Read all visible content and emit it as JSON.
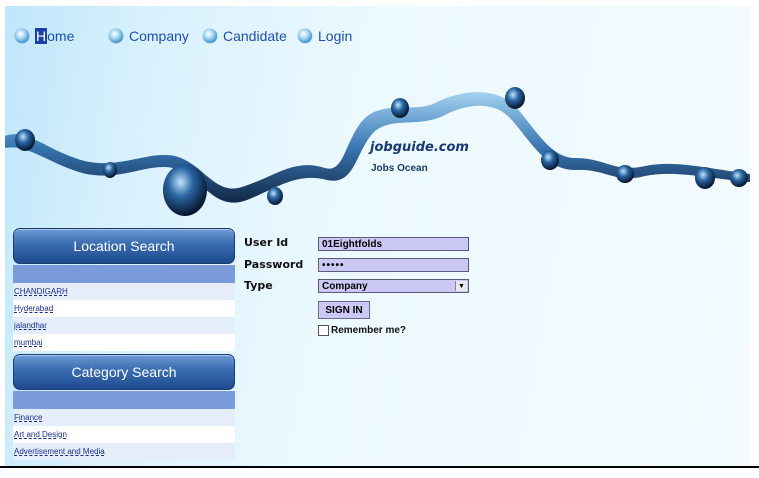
{
  "nav": {
    "items": [
      {
        "label": "Home"
      },
      {
        "label": "Company"
      },
      {
        "label": "Candidate"
      },
      {
        "label": "Login"
      }
    ]
  },
  "banner": {
    "brand": "jobguide.com",
    "tagline": "Jobs Ocean"
  },
  "location_search": {
    "title": "Location Search",
    "items": [
      "CHANDIGARH",
      "Hyderabad",
      "jalandhar",
      "mumbai"
    ]
  },
  "category_search": {
    "title": "Category Search",
    "items": [
      "Finance",
      "Art and Design",
      "Advertisement and Media"
    ]
  },
  "login": {
    "user_id_label": "User Id",
    "user_id_value": "01Eightfolds",
    "password_label": "Password",
    "password_value": "•••••",
    "type_label": "Type",
    "type_value": "Company",
    "signin_label": "SIGN IN",
    "remember_label": "Remember me?"
  }
}
